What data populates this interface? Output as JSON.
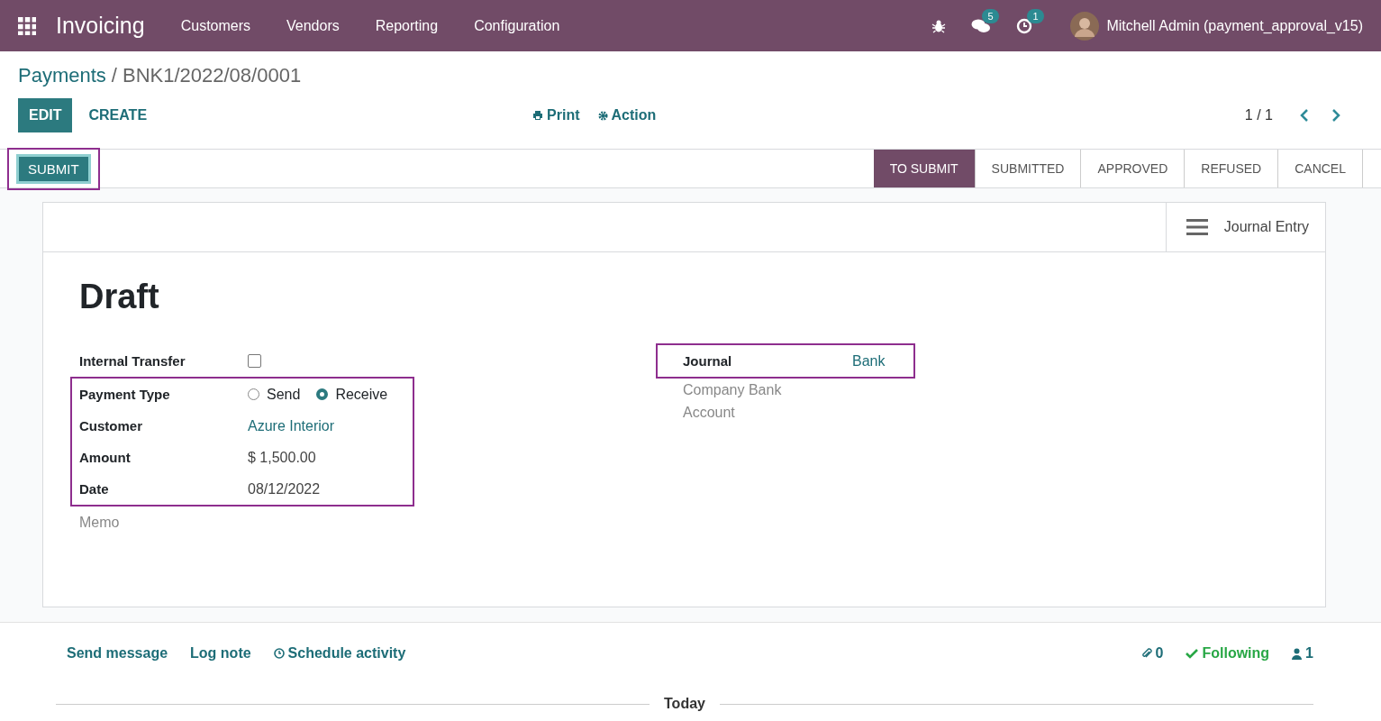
{
  "navbar": {
    "app": "Invoicing",
    "menu": [
      "Customers",
      "Vendors",
      "Reporting",
      "Configuration"
    ],
    "messages_badge": "5",
    "activities_badge": "1",
    "user": "Mitchell Admin (payment_approval_v15)"
  },
  "breadcrumb": {
    "parent": "Payments",
    "separator": "/",
    "current": "BNK1/2022/08/0001"
  },
  "buttons": {
    "edit": "EDIT",
    "create": "CREATE",
    "print": "Print",
    "action": "Action"
  },
  "pager": "1 / 1",
  "statusbar": {
    "button": {
      "label": "SUBMIT",
      "highlighted": true
    },
    "stages": [
      {
        "label": "TO SUBMIT",
        "selected": true
      },
      {
        "label": "SUBMITTED",
        "selected": false
      },
      {
        "label": "APPROVED",
        "selected": false
      },
      {
        "label": "REFUSED",
        "selected": false
      },
      {
        "label": "CANCEL",
        "selected": false
      }
    ]
  },
  "smart_button": "Journal Entry",
  "title": "Draft",
  "internal_transfer": {
    "label": "Internal Transfer",
    "checked": false
  },
  "payment_group": {
    "highlighted": true,
    "payment_type": {
      "label": "Payment Type",
      "options": [
        {
          "label": "Send",
          "selected": false
        },
        {
          "label": "Receive",
          "selected": true
        }
      ]
    },
    "fields": [
      {
        "label": "Customer",
        "value": "Azure Interior",
        "kind": "link"
      },
      {
        "label": "Amount",
        "value": "$ 1,500.00",
        "kind": "text"
      },
      {
        "label": "Date",
        "value": "08/12/2022",
        "kind": "text"
      }
    ]
  },
  "memo": "Memo",
  "journal": {
    "label": "Journal",
    "value": "Bank",
    "highlighted": true
  },
  "bank_account": "Company Bank Account",
  "chatter": {
    "send_message": "Send message",
    "log_note": "Log note",
    "schedule": "Schedule activity",
    "attachments": "0",
    "following": "Following",
    "followers": "1",
    "separator": "Today"
  }
}
